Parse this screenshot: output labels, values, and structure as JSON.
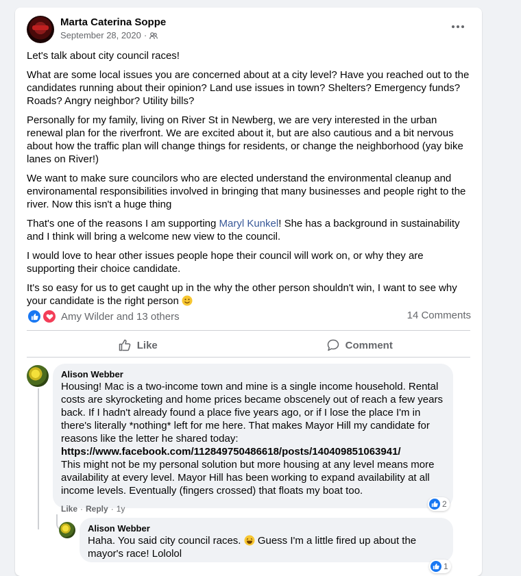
{
  "post": {
    "author": "Marta Caterina Soppe",
    "date": "September 28, 2020",
    "privacy_sep": "·",
    "paragraphs": [
      "Let's talk about city council races!",
      "What are some local issues you are concerned about at a city level? Have you reached out to the candidates running about their opinion? Land use issues in town? Shelters? Emergency funds? Roads? Angry neighbor? Utility bills?",
      "Personally for my family, living on River St in Newberg, we are very interested in the urban renewal plan for the riverfront. We are excited about it, but are also cautious and a bit nervous about how the traffic plan will change things for residents, or change the neighborhood (yay bike lanes on River!)",
      "We want to make sure councilors who are elected understand the environmental cleanup and environamental responsibilities involved in bringing that many businesses and people right to the river. Now this isn't a huge thing"
    ],
    "para5_before": "That's one of the reasons I am supporting ",
    "para5_link": "Maryl Kunkel",
    "para5_after": "! She has a background in sustainability and I think will bring a welcome new view to the council.",
    "para6": "I would love to hear other issues people hope their council will work on, or why they are supporting their choice candidate.",
    "para7": "It's so easy for us to get caught up in the why the other person shouldn't win, I want to see why your candidate is the right person",
    "reactions_text": "Amy Wilder and 13 others",
    "comments_count": "14 Comments",
    "like_label": "Like",
    "comment_label": "Comment"
  },
  "comments": [
    {
      "author": "Alison Webber",
      "text_before_link": "Housing! Mac is a two-income town and mine is a single income household. Rental costs are skyrocketing and home prices became obscenely out of reach a few years back. If I hadn't already found a place five years ago, or if I lose the place I'm in there's literally *nothing* left for me here. That makes Mayor Hill my candidate for reasons like the letter he shared today:",
      "link": "https://www.facebook.com/112849750486618/posts/140409851063941/",
      "text_after_link": "This might not be my personal solution but more housing at any level means more availability at every level. Mayor Hill has been working to expand availability at all income levels. Eventually (fingers crossed) that floats my boat too.",
      "like": "Like",
      "reply": "Reply",
      "time": "1y",
      "dot": "·",
      "reaction_count": "2"
    },
    {
      "author": "Alison Webber",
      "text_before_emoji": "Haha. You said city council races.",
      "text_after_emoji": "Guess I'm a little fired up about the mayor's race! Lololol",
      "reaction_count": "1"
    }
  ],
  "colors": {
    "link": "#385898",
    "like_blue": "#1877f2",
    "love_red": "#f33e58",
    "secondary_text": "#65676b"
  },
  "icons": {
    "privacy": "friends-icon",
    "more": "more-options-icon",
    "like": "thumbs-up-icon",
    "comment": "comment-bubble-icon"
  }
}
